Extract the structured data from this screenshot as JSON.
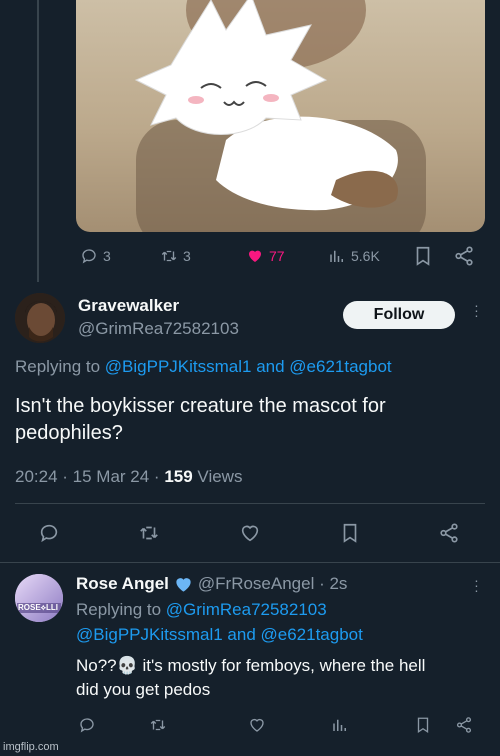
{
  "top_tweet": {
    "stats": {
      "replies": "3",
      "retweets": "3",
      "likes": "77",
      "views": "5.6K"
    },
    "like_color": "#f91880"
  },
  "main_tweet": {
    "display_name": "Gravewalker",
    "handle": "@GrimRea72582103",
    "follow_label": "Follow",
    "replying_prefix": "Replying to",
    "replying_users": "@BigPPJKitssmal1 and @e621tagbot",
    "text_line1": "Isn't the boykisser creature the mascot for",
    "text_line2": "pedophiles?",
    "timestamp": "20:24 · 15 Mar 24 ·",
    "views_count": "159",
    "views_label": "Views"
  },
  "reply": {
    "display_name": "Rose Angel",
    "handle_time": "@FrRoseAngel · 2s",
    "replying_prefix": "Replying to",
    "replying_line1": "@GrimRea72582103",
    "replying_line2": "@BigPPJKitssmal1 and @e621tagbot",
    "text_line1": "No??💀 it's mostly for femboys, where the hell",
    "text_line2": "did you get pedos",
    "avatar_text": "ROSE⟡LLI"
  },
  "watermark": "imgflip.com",
  "colors": {
    "background": "#15202b",
    "accent": "#1d9bf0",
    "verified": "#1d9bf0"
  }
}
